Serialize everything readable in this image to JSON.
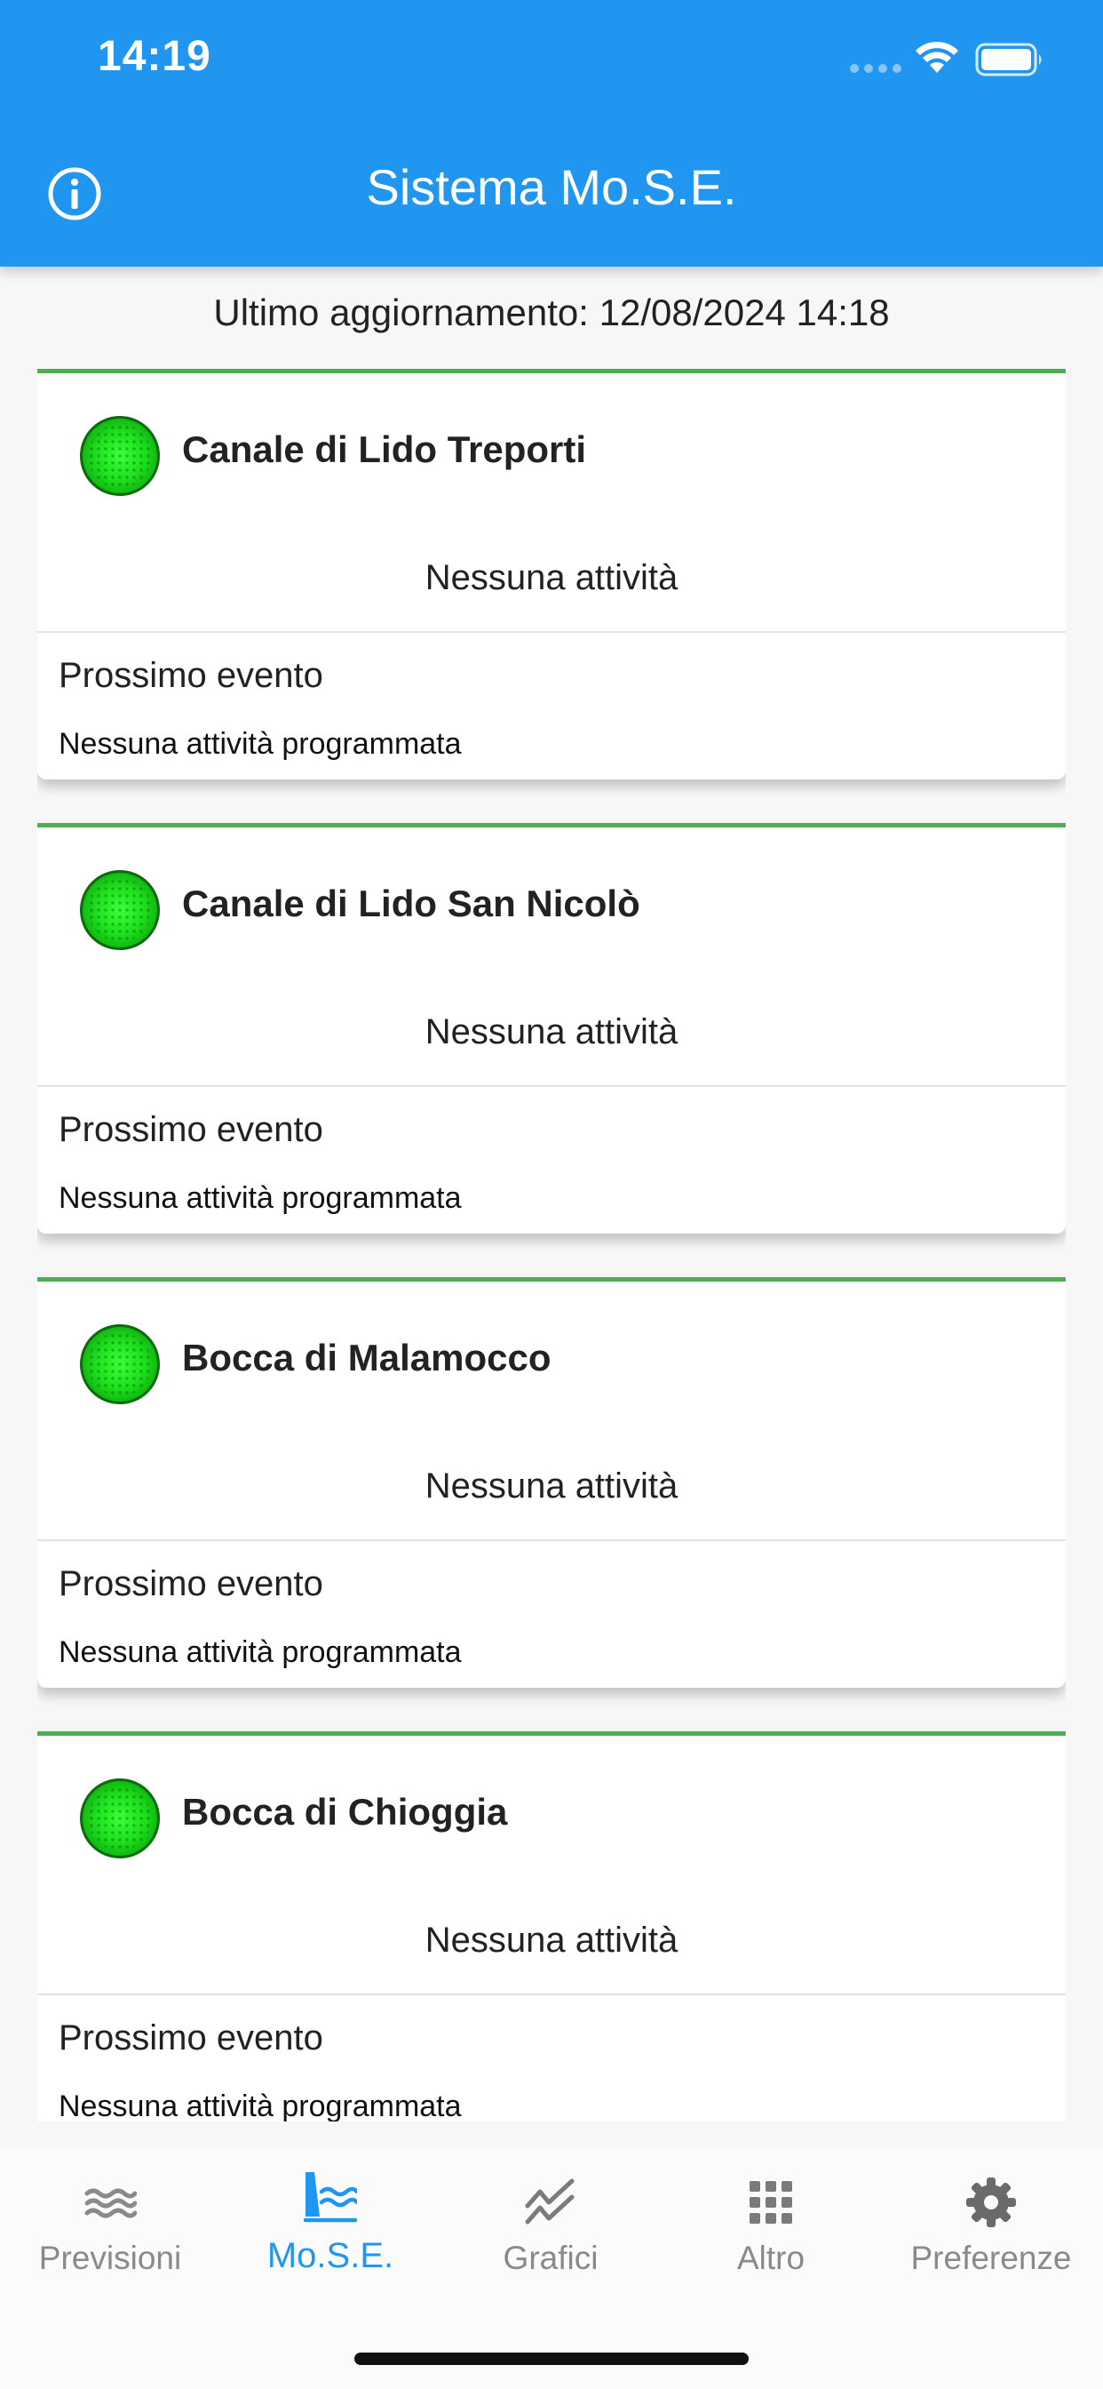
{
  "status_bar": {
    "time": "14:19"
  },
  "header": {
    "title": "Sistema Mo.S.E."
  },
  "last_update": "Ultimo aggiornamento: 12/08/2024 14:18",
  "colors": {
    "accent": "#2196f0",
    "status_green": "#4caf50",
    "inactive_tab": "#8a8a8a"
  },
  "cards": [
    {
      "name": "Canale di Lido Treporti",
      "status": "Nessuna attività",
      "next_label": "Prossimo evento",
      "next_value": "Nessuna attività programmata",
      "lamp": "green"
    },
    {
      "name": "Canale di Lido San Nicolò",
      "status": "Nessuna attività",
      "next_label": "Prossimo evento",
      "next_value": "Nessuna attività programmata",
      "lamp": "green"
    },
    {
      "name": "Bocca di Malamocco",
      "status": "Nessuna attività",
      "next_label": "Prossimo evento",
      "next_value": "Nessuna attività programmata",
      "lamp": "green"
    },
    {
      "name": "Bocca di Chioggia",
      "status": "Nessuna attività",
      "next_label": "Prossimo evento",
      "next_value": "Nessuna attività programmata",
      "lamp": "green"
    }
  ],
  "tabs": [
    {
      "label": "Previsioni",
      "icon": "waves-icon"
    },
    {
      "label": "Mo.S.E.",
      "icon": "barrier-icon",
      "active": true
    },
    {
      "label": "Grafici",
      "icon": "chart-icon"
    },
    {
      "label": "Altro",
      "icon": "grid-icon"
    },
    {
      "label": "Preferenze",
      "icon": "gear-icon"
    }
  ]
}
